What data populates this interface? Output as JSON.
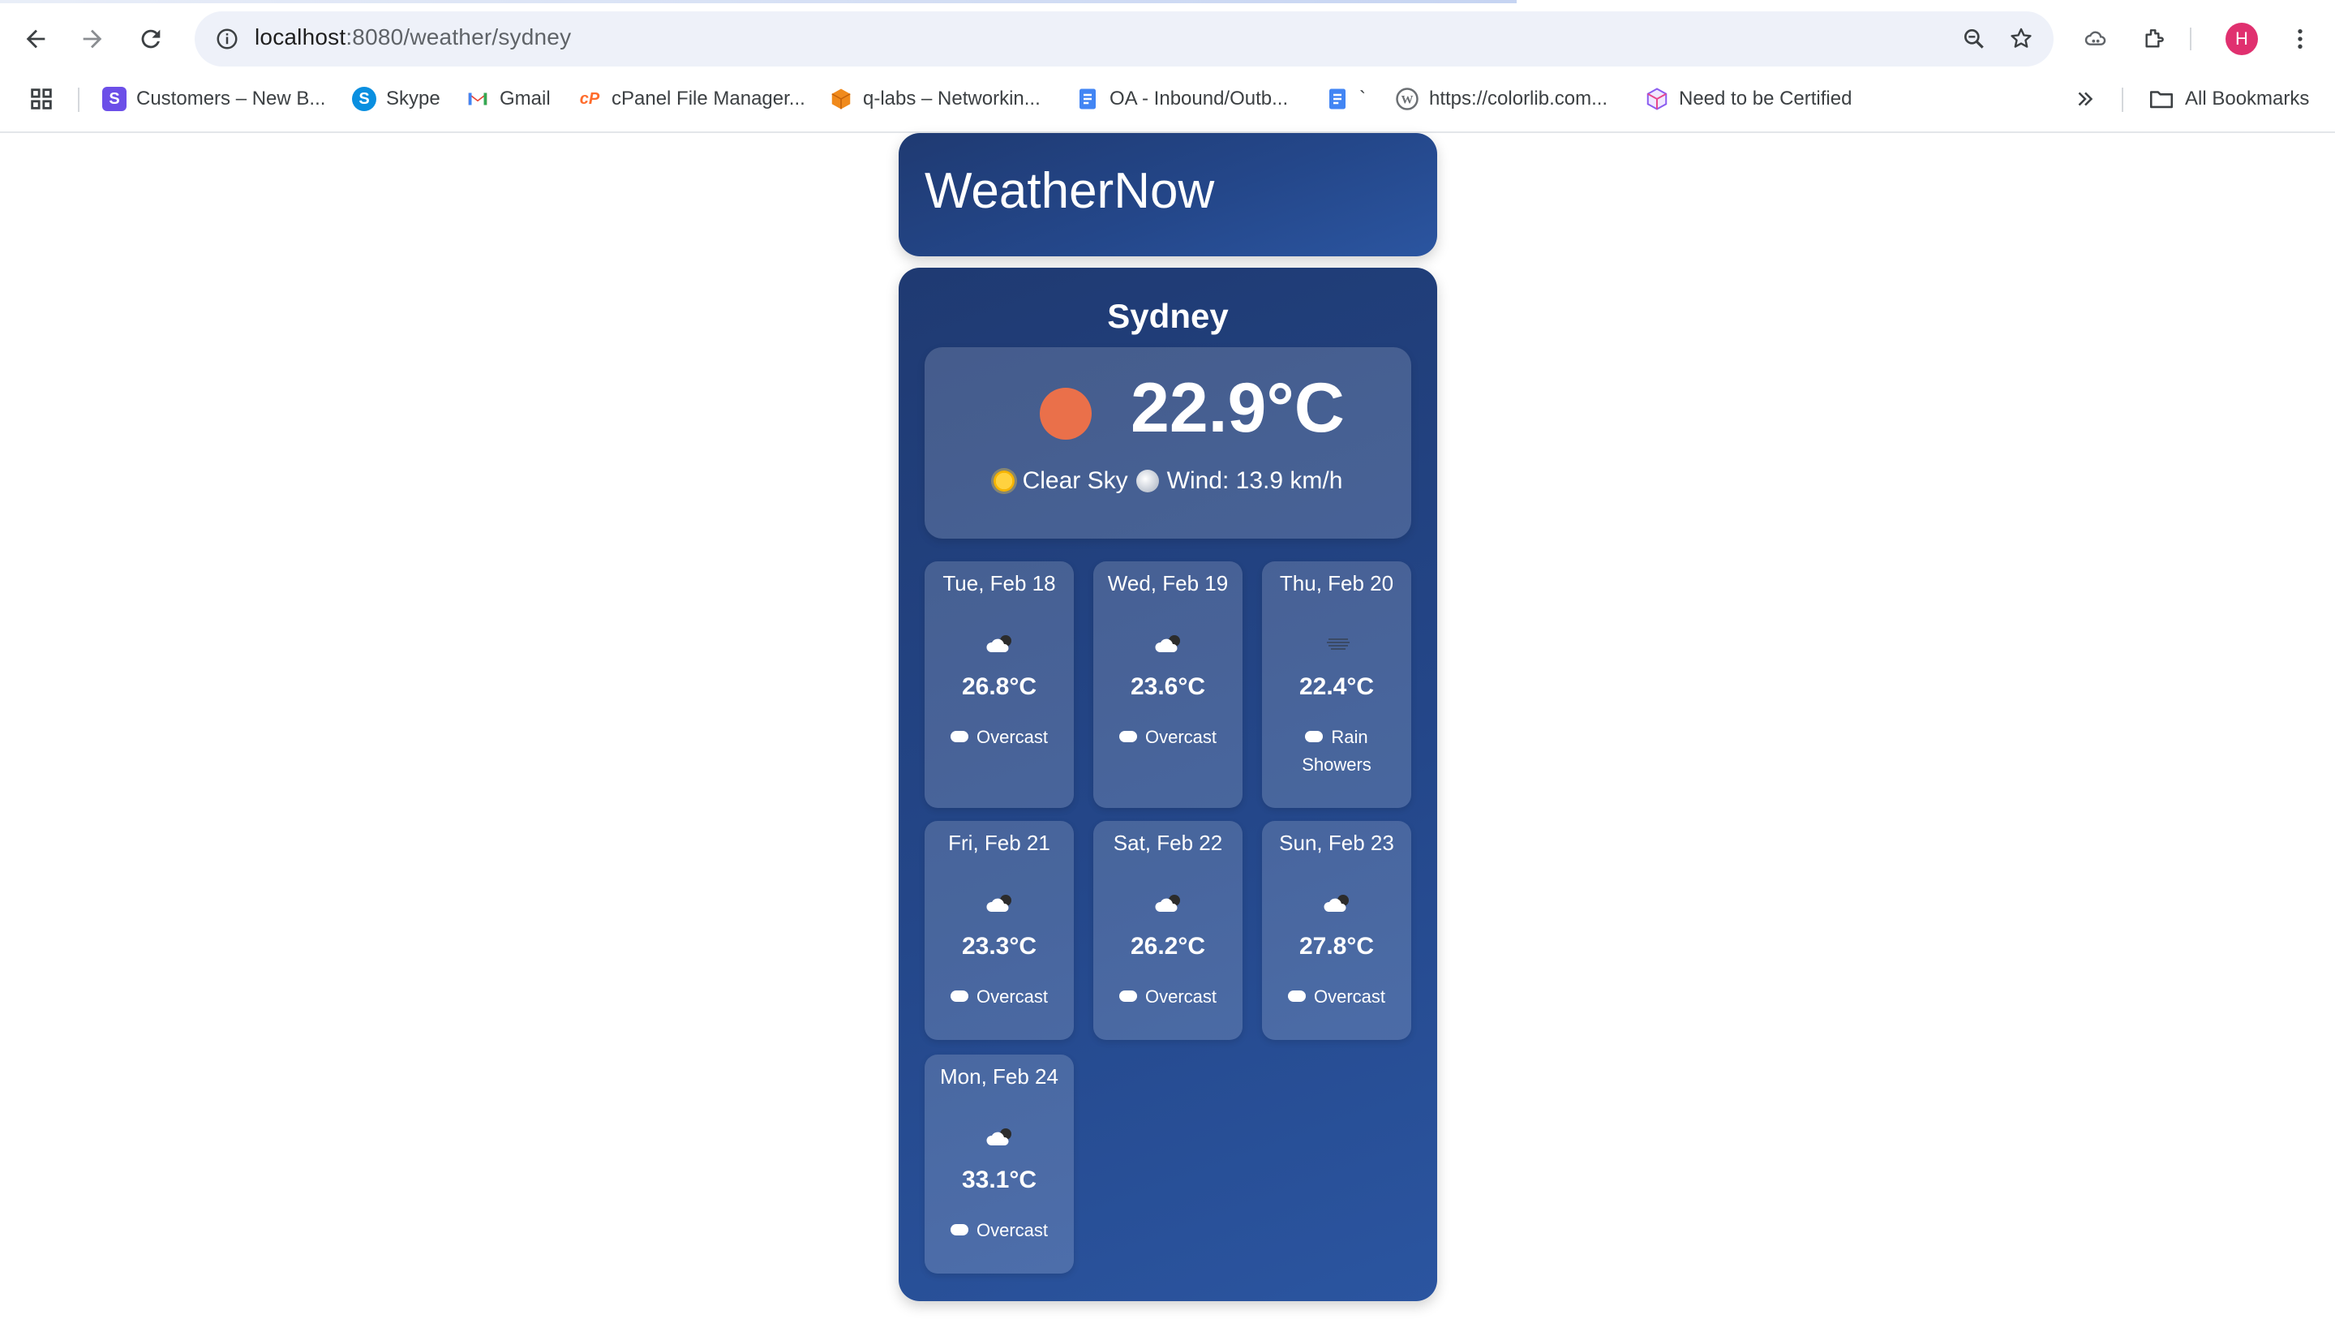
{
  "browser": {
    "url_host": "localhost",
    "url_rest": ":8080/weather/sydney",
    "avatar_letter": "H",
    "bookmarks": [
      {
        "label": "Customers – New B...",
        "icon": "s-icon",
        "color": "#6c4fe8"
      },
      {
        "label": "Skype",
        "icon": "skype-icon",
        "color": "#0a8fe0"
      },
      {
        "label": "Gmail",
        "icon": "gmail-icon",
        "color": "#ea4335"
      },
      {
        "label": "cPanel File Manager...",
        "icon": "cpanel-icon",
        "color": "#ff6c2c"
      },
      {
        "label": "q-labs – Networkin...",
        "icon": "cube-icon",
        "color": "#f08a1c"
      },
      {
        "label": "OA - Inbound/Outb...",
        "icon": "doc-icon",
        "color": "#4285f4"
      },
      {
        "label": "`",
        "icon": "doc-icon",
        "color": "#4285f4"
      },
      {
        "label": "https://colorlib.com...",
        "icon": "wordpress-icon",
        "color": "#6b6f73"
      },
      {
        "label": "Need to be Certified",
        "icon": "box-icon",
        "color": "#8a5cf0"
      }
    ],
    "all_bookmarks_label": "All Bookmarks"
  },
  "app": {
    "title": "WeatherNow",
    "city": "Sydney",
    "current": {
      "temperature": "22.9°C",
      "condition": "Clear Sky",
      "wind": "Wind: 13.9 km/h",
      "icon": "sun-icon"
    },
    "forecast": [
      {
        "date": "Tue, Feb 18",
        "temp": "26.8°C",
        "desc": "Overcast",
        "icon": "partly-cloudy-icon"
      },
      {
        "date": "Wed, Feb 19",
        "temp": "23.6°C",
        "desc": "Overcast",
        "icon": "partly-cloudy-icon"
      },
      {
        "date": "Thu, Feb 20",
        "temp": "22.4°C",
        "desc": "Rain Showers",
        "icon": "fog-icon"
      },
      {
        "date": "Fri, Feb 21",
        "temp": "23.3°C",
        "desc": "Overcast",
        "icon": "partly-cloudy-icon"
      },
      {
        "date": "Sat, Feb 22",
        "temp": "26.2°C",
        "desc": "Overcast",
        "icon": "partly-cloudy-icon"
      },
      {
        "date": "Sun, Feb 23",
        "temp": "27.8°C",
        "desc": "Overcast",
        "icon": "partly-cloudy-icon"
      },
      {
        "date": "Mon, Feb 24",
        "temp": "33.1°C",
        "desc": "Overcast",
        "icon": "partly-cloudy-icon"
      }
    ]
  }
}
